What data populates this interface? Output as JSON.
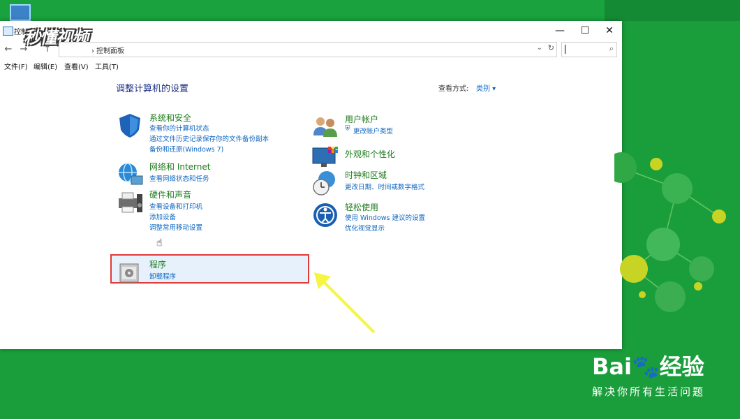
{
  "window": {
    "title": "控制面板",
    "controls": {
      "minimize": "—",
      "maximize": "☐",
      "close": "✕"
    }
  },
  "watermark": {
    "text": "秒懂视频"
  },
  "address": {
    "path": "› 控制面板",
    "dropdown": "⌄",
    "refresh": "↻"
  },
  "search": {
    "placeholder": ""
  },
  "nav": {
    "back": "←",
    "forward": "→",
    "up": "↑"
  },
  "menu": [
    {
      "label": "文件(F)"
    },
    {
      "label": "编辑(E)"
    },
    {
      "label": "查看(V)"
    },
    {
      "label": "工具(T)"
    }
  ],
  "content": {
    "title": "调整计算机的设置",
    "view_by_label": "查看方式:",
    "view_by_value": "类别 ▾"
  },
  "categories_left": [
    {
      "title": "系统和安全",
      "icon": "shield-icon",
      "links": [
        "查看你的计算机状态",
        "通过文件历史记录保存你的文件备份副本",
        "备份和还原(Windows 7)"
      ]
    },
    {
      "title": "网络和 Internet",
      "icon": "network-globe-icon",
      "links": [
        "查看网络状态和任务"
      ]
    },
    {
      "title": "硬件和声音",
      "icon": "printer-speaker-icon",
      "links": [
        "查看设备和打印机",
        "添加设备",
        "调整常用移动设置"
      ]
    },
    {
      "title": "程序",
      "icon": "programs-icon",
      "links": [
        "卸载程序"
      ]
    }
  ],
  "categories_right": [
    {
      "title": "用户帐户",
      "icon": "users-icon",
      "links": [
        "更改帐户类型"
      ]
    },
    {
      "title": "外观和个性化",
      "icon": "monitor-palette-icon",
      "links": []
    },
    {
      "title": "时钟和区域",
      "icon": "clock-globe-icon",
      "links": [
        "更改日期、时间或数字格式"
      ]
    },
    {
      "title": "轻松使用",
      "icon": "ease-of-access-icon",
      "links": [
        "使用 Windows 建议的设置",
        "优化视觉显示"
      ]
    }
  ],
  "brand": {
    "logo": "Bai🐾经验",
    "slogan": "解决你所有生活问题"
  },
  "colors": {
    "desktop_green": "#1a9e3c",
    "link_blue": "#0d66c2",
    "category_green": "#1c7b1c",
    "highlight_red": "#e03a3a",
    "arrow_yellow": "#f5f542"
  }
}
